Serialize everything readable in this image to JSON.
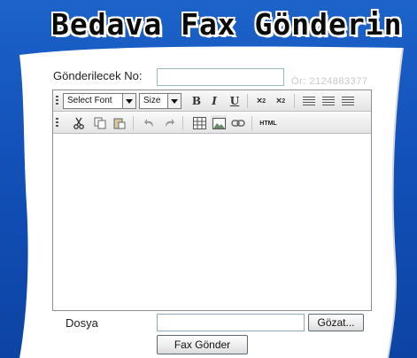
{
  "header": {
    "title": "Bedava Fax Gönderin"
  },
  "form": {
    "number_label": "Gönderilecek No:",
    "number_value": "",
    "number_hint": "Ör: 2124883377",
    "file_label": "Dosya",
    "file_value": "",
    "browse_label": "Gözat...",
    "send_label": "Fax Gönder"
  },
  "editor": {
    "font_select": "Select Font",
    "size_select": "Size",
    "html_button": "HTML",
    "content": ""
  },
  "colors": {
    "background": "#1250b8",
    "paper": "#ffffff",
    "hint": "#c8c8c8"
  }
}
